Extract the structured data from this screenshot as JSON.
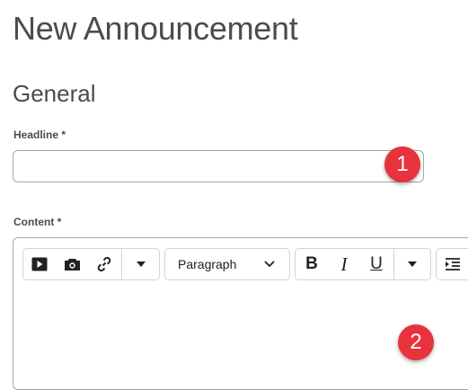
{
  "page": {
    "title": "New Announcement"
  },
  "section": {
    "title": "General"
  },
  "headline": {
    "label": "Headline *",
    "value": "",
    "placeholder": ""
  },
  "content": {
    "label": "Content *"
  },
  "toolbar": {
    "insert_group": [
      {
        "icon": "video-play-icon",
        "tooltip": ""
      },
      {
        "icon": "camera-icon",
        "tooltip": ""
      },
      {
        "icon": "link-icon",
        "tooltip": ""
      },
      {
        "icon": "chevron-down-icon",
        "tooltip": ""
      }
    ],
    "paragraph_select": {
      "value": "Paragraph"
    },
    "format_group": [
      "B",
      "I",
      "U"
    ]
  },
  "markers": {
    "one": "1",
    "two": "2"
  },
  "colors": {
    "marker": "#e8323c",
    "border": "#a3a7ab",
    "text": "#494c4e"
  }
}
